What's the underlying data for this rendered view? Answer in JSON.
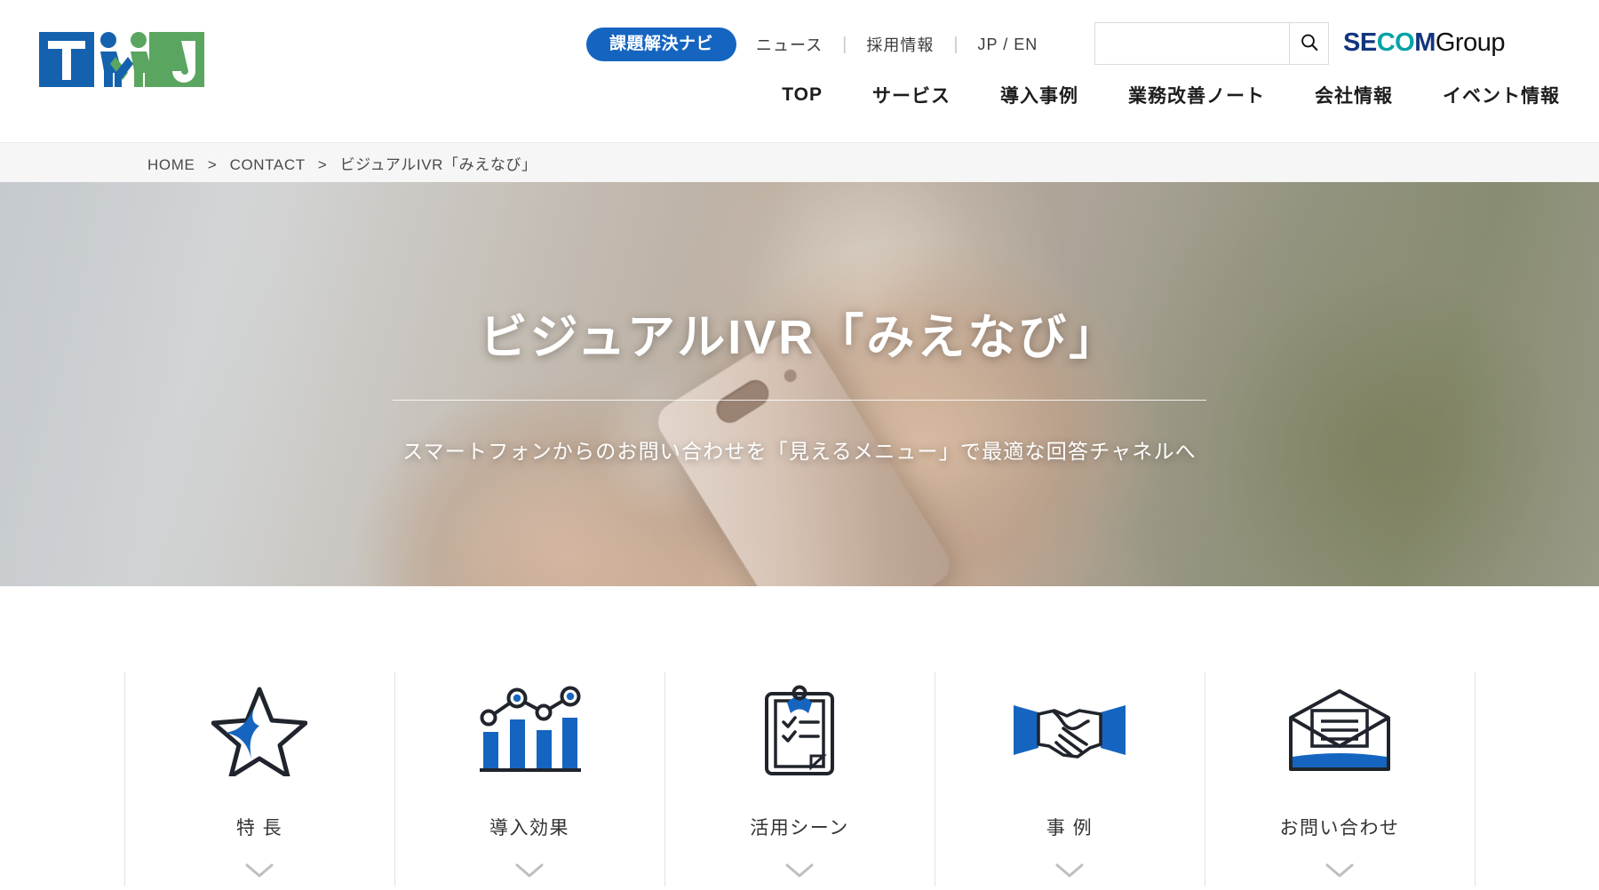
{
  "header": {
    "logo_alt": "TMJ",
    "pill_label": "課題解決ナビ",
    "util_links": [
      "ニュース",
      "採用情報",
      "JP / EN"
    ],
    "search": {
      "value": "",
      "placeholder": ""
    },
    "secom": {
      "part1": "SE",
      "part2": "CO",
      "part3": "M",
      "part4": "Group"
    },
    "mainnav": [
      "TOP",
      "サービス",
      "導入事例",
      "業務改善ノート",
      "会社情報",
      "イベント情報"
    ]
  },
  "breadcrumb": {
    "items": [
      "HOME",
      "CONTACT",
      "ビジュアルIVR「みえなび」"
    ],
    "separator": ">"
  },
  "hero": {
    "title": "ビジュアルIVR「みえなび」",
    "subtitle": "スマートフォンからのお問い合わせを「見えるメニュー」で最適な回答チャネルへ"
  },
  "iconnav": {
    "items": [
      {
        "label": "特 長",
        "icon": "star-icon"
      },
      {
        "label": "導入効果",
        "icon": "bar-chart-icon"
      },
      {
        "label": "活用シーン",
        "icon": "clipboard-check-icon"
      },
      {
        "label": "事 例",
        "icon": "handshake-icon"
      },
      {
        "label": "お問い合わせ",
        "icon": "open-envelope-icon"
      }
    ]
  },
  "colors": {
    "brand_blue": "#1565c0",
    "logo_blue": "#1462ad",
    "logo_green": "#5aa560",
    "icon_blue": "#1565c0",
    "icon_dark": "#20242c",
    "secom_navy": "#12357f",
    "secom_teal": "#00a3a8"
  }
}
